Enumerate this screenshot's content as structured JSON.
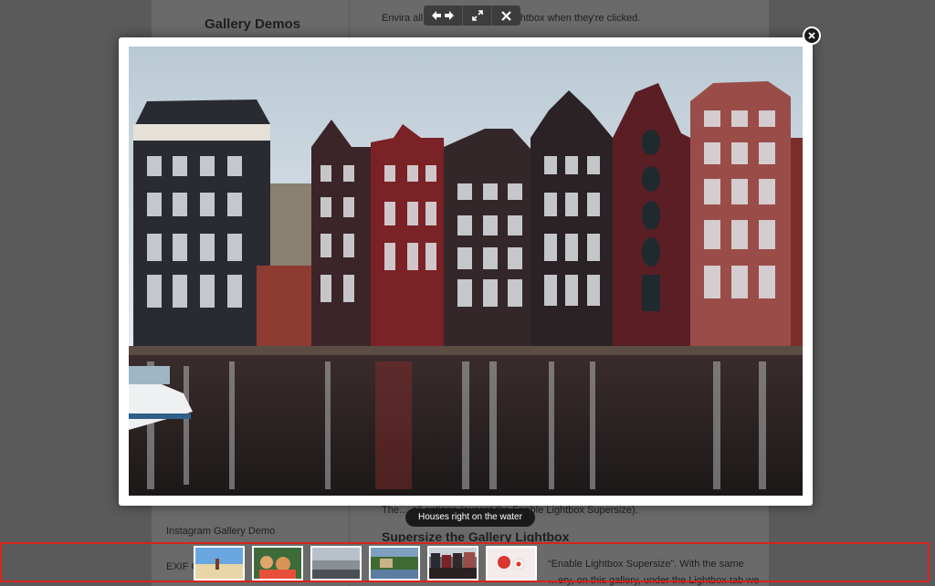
{
  "background_page": {
    "sidebar_title": "Gallery Demos",
    "intro_text": "Envira all… your photos in a lightbox when they're clicked.",
    "options_text": "The… all options (except the Enable Lightbox Supersize).",
    "section_heading": "Supersize the Gallery Lightbox",
    "sidebar_links": [
      "Instagram Gallery Demo",
      "EXIF C…"
    ],
    "bottom_text": [
      "“Enable Lightbox Supersize”.  With the same",
      "…ery, on this gallery, under the Lightbox tab we"
    ]
  },
  "toolbar": {
    "buttons": [
      {
        "name": "prev-next",
        "icon": "arrows-left-right-icon"
      },
      {
        "name": "fullscreen",
        "icon": "expand-icon"
      },
      {
        "name": "close",
        "icon": "close-icon"
      }
    ]
  },
  "lightbox": {
    "caption": "Houses right on the water",
    "close_icon": "close-circle-icon",
    "image_subject": "canal-houses-photo"
  },
  "thumbnails": {
    "items": [
      {
        "label": "beach"
      },
      {
        "label": "people"
      },
      {
        "label": "city"
      },
      {
        "label": "village"
      },
      {
        "label": "canal-houses"
      },
      {
        "label": "food"
      }
    ],
    "highlight_color": "#d6241b"
  }
}
